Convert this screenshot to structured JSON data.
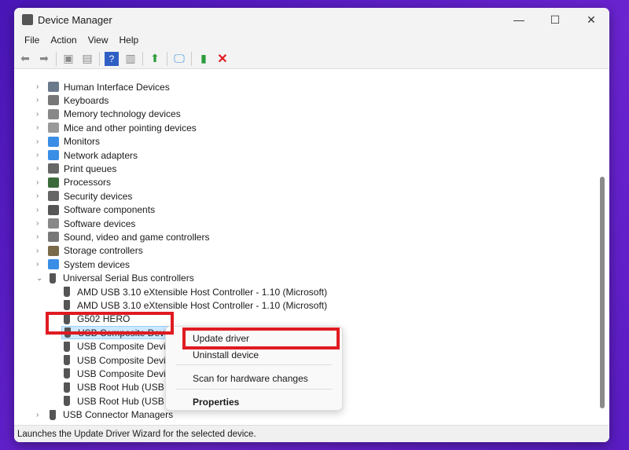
{
  "window": {
    "title": "Device Manager",
    "controls": [
      "—",
      "☐",
      "✕"
    ]
  },
  "menu": [
    "File",
    "Action",
    "View",
    "Help"
  ],
  "toolbar": [
    "back-icon",
    "forward-icon",
    "properties-icon",
    "show-hide-icon",
    "help-icon",
    "view-icon",
    "update-driver-icon",
    "scan-icon",
    "enable-device-icon",
    "uninstall-icon"
  ],
  "tree": {
    "categories": [
      {
        "label": "Human Interface Devices",
        "color": "#6b7a8a"
      },
      {
        "label": "Keyboards",
        "color": "#777"
      },
      {
        "label": "Memory technology devices",
        "color": "#888"
      },
      {
        "label": "Mice and other pointing devices",
        "color": "#999"
      },
      {
        "label": "Monitors",
        "color": "#3a8ee6"
      },
      {
        "label": "Network adapters",
        "color": "#3a8ee6"
      },
      {
        "label": "Print queues",
        "color": "#666"
      },
      {
        "label": "Processors",
        "color": "#3b6b3b"
      },
      {
        "label": "Security devices",
        "color": "#666"
      },
      {
        "label": "Software components",
        "color": "#555"
      },
      {
        "label": "Software devices",
        "color": "#888"
      },
      {
        "label": "Sound, video and game controllers",
        "color": "#777"
      },
      {
        "label": "Storage controllers",
        "color": "#7a6a4a"
      },
      {
        "label": "System devices",
        "color": "#3a8ee6"
      }
    ],
    "usb_category": "Universal Serial Bus controllers",
    "usb_children": [
      "AMD USB 3.10 eXtensible Host Controller - 1.10 (Microsoft)",
      "AMD USB 3.10 eXtensible Host Controller - 1.10 (Microsoft)",
      "G502 HERO",
      "USB Composite Device",
      "USB Composite Device",
      "USB Composite Device",
      "USB Composite Device",
      "USB Root Hub (USB 3.0)",
      "USB Root Hub (USB 3.0)"
    ],
    "selected_index": 3,
    "last_category": "USB Connector Managers"
  },
  "context_menu": {
    "update": "Update driver",
    "uninstall": "Uninstall device",
    "scan": "Scan for hardware changes",
    "properties": "Properties"
  },
  "status": "Launches the Update Driver Wizard for the selected device.",
  "colors": {
    "highlight": "#e01b22",
    "selection": "#cce8ff"
  }
}
